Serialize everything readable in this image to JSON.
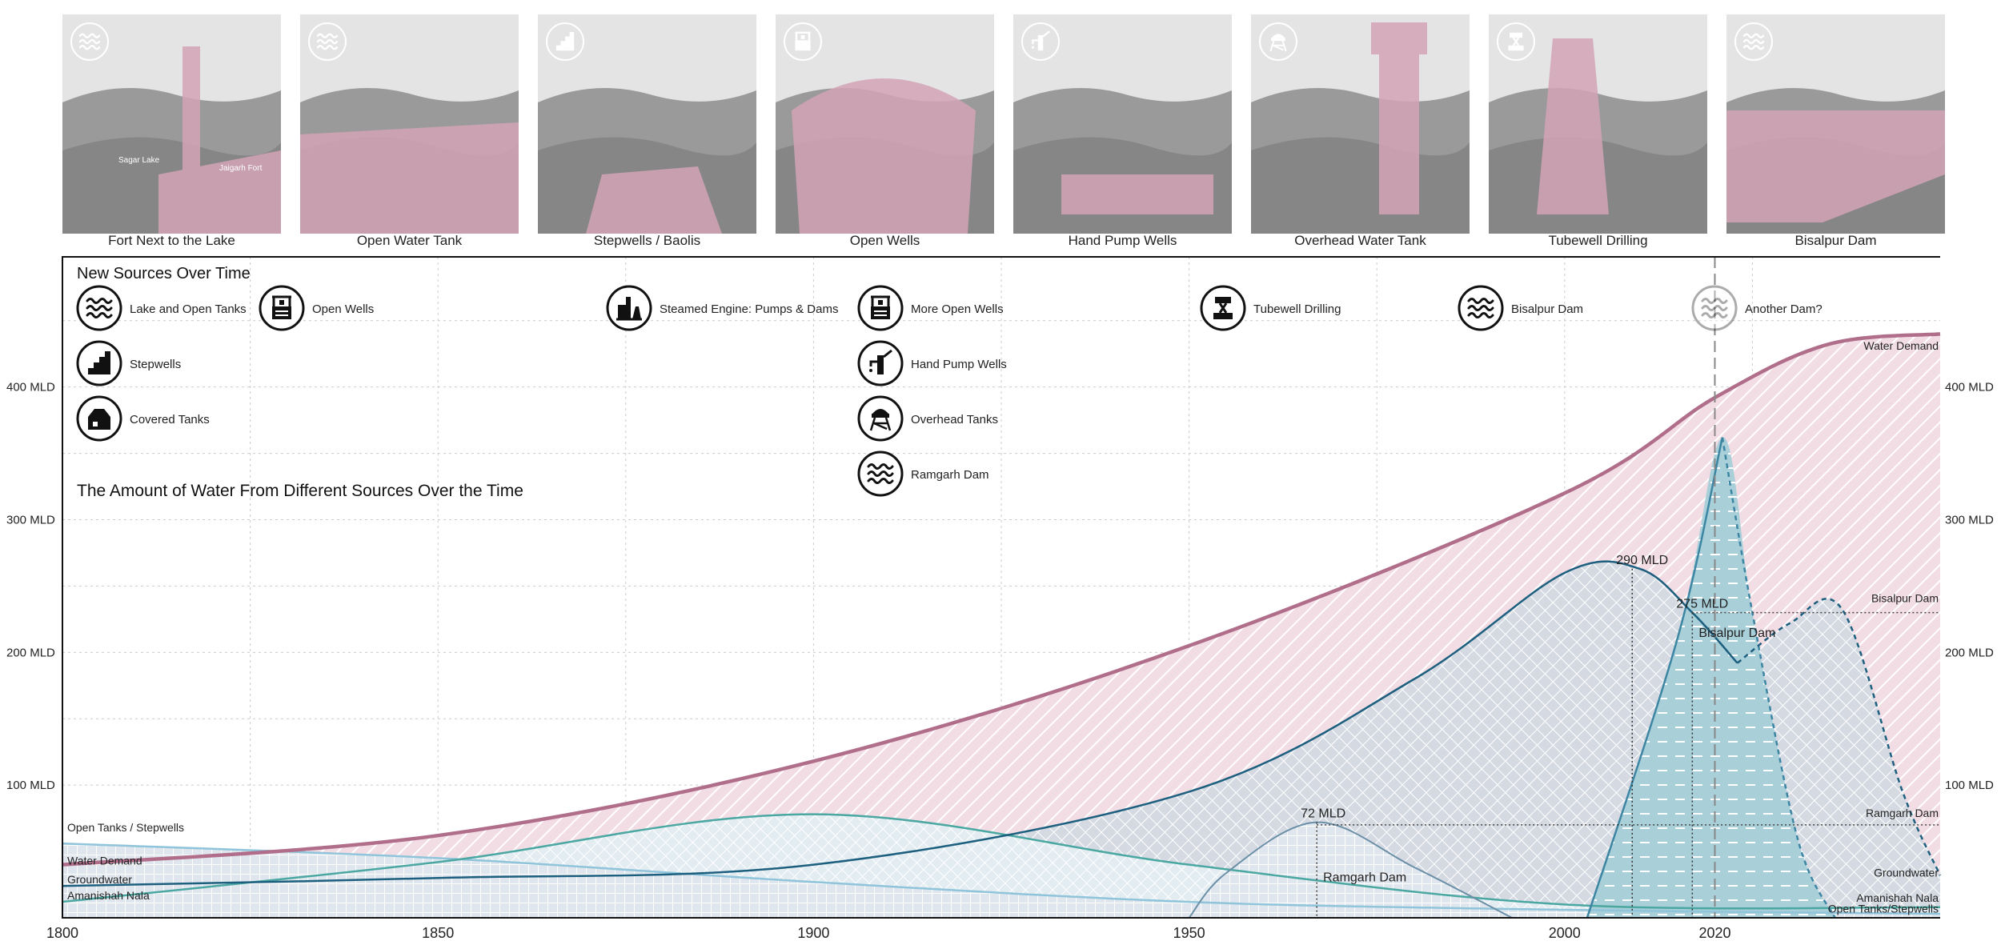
{
  "photos": [
    {
      "caption": "Fort Next to the Lake",
      "icon": "waves-icon",
      "tags": [
        "Jaigarh Fort",
        "Sagar Lake"
      ]
    },
    {
      "caption": "Open Water Tank",
      "icon": "waves-icon",
      "tags": []
    },
    {
      "caption": "Stepwells / Baolis",
      "icon": "stepwell-icon",
      "tags": []
    },
    {
      "caption": "Open Wells",
      "icon": "well-icon",
      "tags": []
    },
    {
      "caption": "Hand Pump Wells",
      "icon": "hand-pump-icon",
      "tags": []
    },
    {
      "caption": "Overhead Water Tank",
      "icon": "water-tower-icon",
      "tags": []
    },
    {
      "caption": "Tubewell Drilling",
      "icon": "drill-icon",
      "tags": []
    },
    {
      "caption": "Bisalpur Dam",
      "icon": "waves-icon",
      "tags": []
    }
  ],
  "legend": {
    "title": "New Sources Over Time",
    "items": [
      {
        "label": "Lake and Open Tanks",
        "icon": "waves-icon",
        "faded": false
      },
      {
        "label": "Stepwells",
        "icon": "stepwell-icon",
        "faded": false
      },
      {
        "label": "Covered Tanks",
        "icon": "covered-tank-icon",
        "faded": false
      },
      {
        "label": "Open Wells",
        "icon": "well-icon",
        "faded": false
      },
      {
        "label": "Steamed Engine: Pumps & Dams",
        "icon": "steam-engine-icon",
        "faded": false
      },
      {
        "label": "More Open Wells",
        "icon": "well-icon",
        "faded": false
      },
      {
        "label": "Hand Pump Wells",
        "icon": "hand-pump-icon",
        "faded": false
      },
      {
        "label": "Overhead Tanks",
        "icon": "water-tower-icon",
        "faded": false
      },
      {
        "label": "Ramgarh Dam",
        "icon": "waves-icon",
        "faded": false
      },
      {
        "label": "Tubewell Drilling",
        "icon": "drill-icon",
        "faded": false
      },
      {
        "label": "Bisalpur Dam",
        "icon": "waves-icon",
        "faded": false
      },
      {
        "label": "Another Dam?",
        "icon": "waves-icon",
        "faded": true
      }
    ]
  },
  "chart_data": {
    "type": "area",
    "title": "The Amount of Water From Different Sources Over the Time",
    "xlabel": "",
    "ylabel": "",
    "x_ticks": [
      1800,
      1850,
      1900,
      1950,
      2000,
      2020
    ],
    "xlim": [
      1800,
      2050
    ],
    "y_ticks": [
      {
        "value": 100,
        "label": "100 MLD"
      },
      {
        "value": 200,
        "label": "200 MLD"
      },
      {
        "value": 300,
        "label": "300 MLD"
      },
      {
        "value": 400,
        "label": "400 MLD"
      }
    ],
    "ylim": [
      0,
      480
    ],
    "grid": true,
    "current_year": 2020,
    "series": [
      {
        "name": "Water Demand",
        "color": "#b06e8b",
        "x": [
          1800,
          1850,
          1900,
          1950,
          2000,
          2020,
          2035,
          2050
        ],
        "y": [
          40,
          62,
          118,
          205,
          320,
          392,
          432,
          440
        ]
      },
      {
        "name": "Groundwater",
        "color": "#1d5f7e",
        "x": [
          1800,
          1850,
          1900,
          1950,
          1980,
          2000,
          2010,
          2017,
          2023,
          2030,
          2037,
          2045,
          2050
        ],
        "y": [
          24,
          30,
          40,
          95,
          180,
          260,
          263,
          230,
          192,
          222,
          232,
          95,
          32
        ]
      },
      {
        "name": "Open Tanks / Stepwells",
        "color": "#8fc4da",
        "x": [
          1800,
          1850,
          1900,
          1950,
          2000,
          2050
        ],
        "y": [
          56,
          45,
          27,
          12,
          6,
          3
        ]
      },
      {
        "name": "Amanishah Nala",
        "color": "#4aa7a1",
        "x": [
          1800,
          1850,
          1900,
          1950,
          2000,
          2050
        ],
        "y": [
          12,
          42,
          78,
          40,
          10,
          8
        ]
      },
      {
        "name": "Ramgarh Dam",
        "color": "#6b8fa6",
        "x": [
          1950,
          1955,
          1967,
          1980,
          1993
        ],
        "y": [
          0,
          34,
          72,
          38,
          0
        ]
      },
      {
        "name": "Bisalpur Dam",
        "color": "#3d86a3",
        "x": [
          2003,
          2015,
          2021,
          2025,
          2031,
          2036
        ],
        "y": [
          0,
          210,
          362,
          230,
          60,
          0
        ]
      }
    ],
    "annotations": [
      {
        "text": "290 MLD",
        "x": 2009,
        "y": 263
      },
      {
        "text": "275 MLD",
        "x": 2017,
        "y": 230
      },
      {
        "text": "72 MLD",
        "x": 1967,
        "y": 72
      },
      {
        "text": "Bisalpur Dam",
        "x": 2017,
        "y": 220
      },
      {
        "text": "Ramgarh Dam",
        "x": 1967,
        "y": 36
      }
    ],
    "reference_lines": [
      {
        "label": "Bisalpur Dam",
        "y": 230
      },
      {
        "label": "Ramgarh Dam",
        "y": 70
      }
    ],
    "left_labels": [
      {
        "text": "Open Tanks / Stepwells",
        "y": 65
      },
      {
        "text": "Water Demand",
        "y": 40
      },
      {
        "text": "Groundwater",
        "y": 26
      },
      {
        "text": "Amanishah Nala",
        "y": 14
      }
    ],
    "right_labels": [
      {
        "text": "Water Demand",
        "y": 428
      },
      {
        "text": "Bisalpur Dam",
        "y": 238
      },
      {
        "text": "Ramgarh Dam",
        "y": 76
      },
      {
        "text": "Groundwater",
        "y": 31
      },
      {
        "text": "Amanishah Nala",
        "y": 12
      },
      {
        "text": "Open Tanks/Stepwells",
        "y": 4
      }
    ]
  }
}
